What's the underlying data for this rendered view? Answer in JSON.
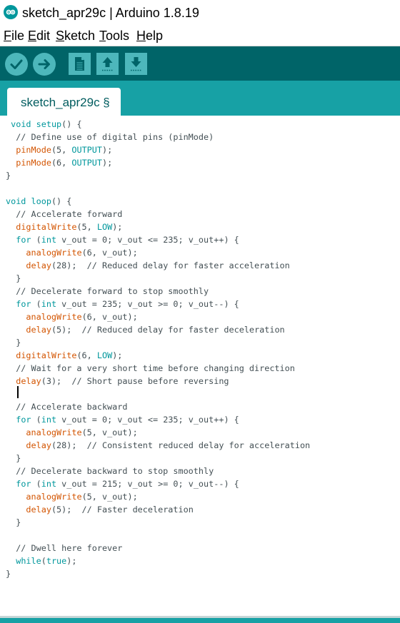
{
  "window": {
    "title": "sketch_apr29c | Arduino 1.8.19"
  },
  "menu": [
    {
      "label": "File",
      "key": "F",
      "rest": "ile"
    },
    {
      "label": "Edit",
      "key": "E",
      "rest": "dit"
    },
    {
      "label": "Sketch",
      "key": "S",
      "rest": "ketch"
    },
    {
      "label": "Tools",
      "key": "T",
      "rest": "ools"
    },
    {
      "label": "Help",
      "key": "H",
      "rest": "elp"
    }
  ],
  "toolbar": {
    "buttons": [
      {
        "icon": "verify-checkmark-icon"
      },
      {
        "icon": "upload-arrow-icon"
      },
      {
        "icon": "new-document-icon"
      },
      {
        "icon": "open-up-arrow-icon"
      },
      {
        "icon": "save-down-arrow-icon"
      }
    ]
  },
  "tab": {
    "label": "sketch_apr29c §"
  },
  "code": [
    [
      [
        "",
        " "
      ],
      [
        "kw",
        "void"
      ],
      [
        "",
        " "
      ],
      [
        "kw",
        "setup"
      ],
      [
        "",
        "() {"
      ]
    ],
    [
      [
        "cm",
        "  // Define use of digital pins (pinMode)"
      ]
    ],
    [
      [
        "",
        "  "
      ],
      [
        "fn",
        "pinMode"
      ],
      [
        "",
        "(5, "
      ],
      [
        "kw",
        "OUTPUT"
      ],
      [
        "",
        ");"
      ]
    ],
    [
      [
        "",
        "  "
      ],
      [
        "fn",
        "pinMode"
      ],
      [
        "",
        "(6, "
      ],
      [
        "kw",
        "OUTPUT"
      ],
      [
        "",
        ");"
      ]
    ],
    [
      [
        "",
        "}"
      ]
    ],
    [
      [
        "",
        ""
      ]
    ],
    [
      [
        "kw",
        "void"
      ],
      [
        "",
        " "
      ],
      [
        "kw",
        "loop"
      ],
      [
        "",
        "() {"
      ]
    ],
    [
      [
        "cm",
        "  // Accelerate forward"
      ]
    ],
    [
      [
        "",
        "  "
      ],
      [
        "fn",
        "digitalWrite"
      ],
      [
        "",
        "(5, "
      ],
      [
        "kw",
        "LOW"
      ],
      [
        "",
        ");"
      ]
    ],
    [
      [
        "",
        "  "
      ],
      [
        "kw",
        "for"
      ],
      [
        "",
        " ("
      ],
      [
        "kw",
        "int"
      ],
      [
        "",
        " v_out = 0; v_out <= 235; v_out++) {"
      ]
    ],
    [
      [
        "",
        "    "
      ],
      [
        "fn",
        "analogWrite"
      ],
      [
        "",
        "(6, v_out);"
      ]
    ],
    [
      [
        "",
        "    "
      ],
      [
        "fn",
        "delay"
      ],
      [
        "",
        "(28);  // Reduced delay for faster acceleration"
      ]
    ],
    [
      [
        "",
        "  }"
      ]
    ],
    [
      [
        "cm",
        "  // Decelerate forward to stop smoothly"
      ]
    ],
    [
      [
        "",
        "  "
      ],
      [
        "kw",
        "for"
      ],
      [
        "",
        " ("
      ],
      [
        "kw",
        "int"
      ],
      [
        "",
        " v_out = 235; v_out >= 0; v_out--) {"
      ]
    ],
    [
      [
        "",
        "    "
      ],
      [
        "fn",
        "analogWrite"
      ],
      [
        "",
        "(6, v_out);"
      ]
    ],
    [
      [
        "",
        "    "
      ],
      [
        "fn",
        "delay"
      ],
      [
        "",
        "(5);  // Reduced delay for faster deceleration"
      ]
    ],
    [
      [
        "",
        "  }"
      ]
    ],
    [
      [
        "",
        "  "
      ],
      [
        "fn",
        "digitalWrite"
      ],
      [
        "",
        "(6, "
      ],
      [
        "kw",
        "LOW"
      ],
      [
        "",
        ");"
      ]
    ],
    [
      [
        "cm",
        "  // Wait for a very short time before changing direction"
      ]
    ],
    [
      [
        "",
        "  "
      ],
      [
        "fn",
        "delay"
      ],
      [
        "",
        "(3);  // Short pause before reversing"
      ]
    ],
    [
      [
        "",
        ""
      ]
    ],
    [
      [
        "cm",
        "  // Accelerate backward"
      ]
    ],
    [
      [
        "",
        "  "
      ],
      [
        "kw",
        "for"
      ],
      [
        "",
        " ("
      ],
      [
        "kw",
        "int"
      ],
      [
        "",
        " v_out = 0; v_out <= 235; v_out++) {"
      ]
    ],
    [
      [
        "",
        "    "
      ],
      [
        "fn",
        "analogWrite"
      ],
      [
        "",
        "(5, v_out);"
      ]
    ],
    [
      [
        "",
        "    "
      ],
      [
        "fn",
        "delay"
      ],
      [
        "",
        "(28);  // Consistent reduced delay for acceleration"
      ]
    ],
    [
      [
        "",
        "  }"
      ]
    ],
    [
      [
        "cm",
        "  // Decelerate backward to stop smoothly"
      ]
    ],
    [
      [
        "",
        "  "
      ],
      [
        "kw",
        "for"
      ],
      [
        "",
        " ("
      ],
      [
        "kw",
        "int"
      ],
      [
        "",
        " v_out = 215; v_out >= 0; v_out--) {"
      ]
    ],
    [
      [
        "",
        "    "
      ],
      [
        "fn",
        "analogWrite"
      ],
      [
        "",
        "(5, v_out);"
      ]
    ],
    [
      [
        "",
        "    "
      ],
      [
        "fn",
        "delay"
      ],
      [
        "",
        "(5);  // Faster deceleration"
      ]
    ],
    [
      [
        "",
        "  }"
      ]
    ],
    [
      [
        "",
        ""
      ]
    ],
    [
      [
        "cm",
        "  // Dwell here forever"
      ]
    ],
    [
      [
        "",
        "  "
      ],
      [
        "kw",
        "while"
      ],
      [
        "",
        "("
      ],
      [
        "kw",
        "true"
      ],
      [
        "",
        ");"
      ]
    ],
    [
      [
        "",
        "}"
      ]
    ]
  ],
  "colors": {
    "keyword": "#00979c",
    "function": "#d35400",
    "text": "#434f54",
    "toolbar_bg": "#006468",
    "tabstrip_bg": "#17a1a5",
    "button": "#4db7bb"
  }
}
